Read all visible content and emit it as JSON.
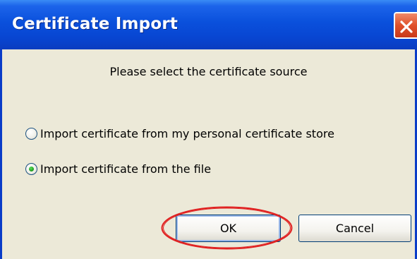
{
  "window": {
    "title": "Certificate Import",
    "close_icon": "close-icon"
  },
  "dialog": {
    "prompt": "Please select the certificate source",
    "options": [
      {
        "label": "Import certificate from my personal certificate store",
        "selected": false
      },
      {
        "label": "Import certificate from the file",
        "selected": true
      }
    ],
    "ok_label": "OK",
    "cancel_label": "Cancel"
  },
  "colors": {
    "titlebar": "#0a50dc",
    "dialog_bg": "#ece9d8",
    "highlight_ring": "#e02020"
  }
}
